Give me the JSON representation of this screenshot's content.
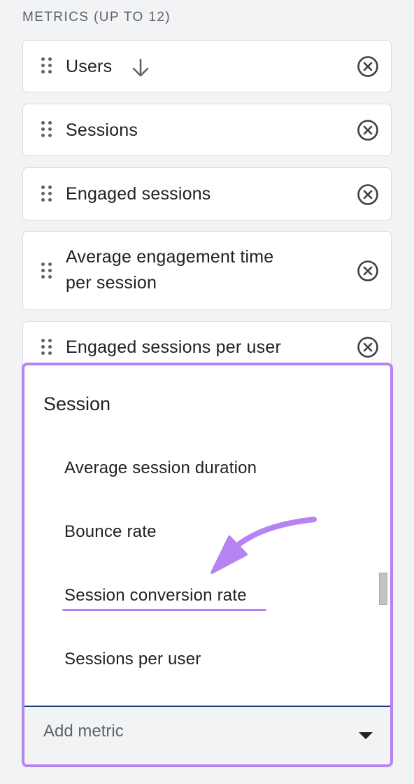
{
  "section": {
    "title": "METRICS (UP TO 12)"
  },
  "metrics": [
    {
      "label": "Users",
      "sort_icon": "arrow-down-icon",
      "remove_icon": "close-circle-icon"
    },
    {
      "label": "Sessions",
      "remove_icon": "close-circle-icon"
    },
    {
      "label": "Engaged sessions",
      "remove_icon": "close-circle-icon"
    },
    {
      "label_line1": "Average engagement time",
      "label_line2": "per session",
      "remove_icon": "close-circle-icon"
    },
    {
      "label": "Engaged sessions per user",
      "remove_icon": "close-circle-icon"
    }
  ],
  "dropdown": {
    "group_heading": "Session",
    "items": [
      {
        "label": "Average session duration"
      },
      {
        "label": "Bounce rate"
      },
      {
        "label": "Session conversion rate",
        "highlighted": true
      },
      {
        "label": "Sessions per user"
      }
    ],
    "add_metric_placeholder": "Add metric",
    "caret_icon": "caret-down-icon"
  },
  "colors": {
    "highlight": "#b683f2",
    "chip_border": "#dadce0",
    "background": "#f1f3f4",
    "text": "#202124",
    "muted_text": "#5f6368"
  }
}
